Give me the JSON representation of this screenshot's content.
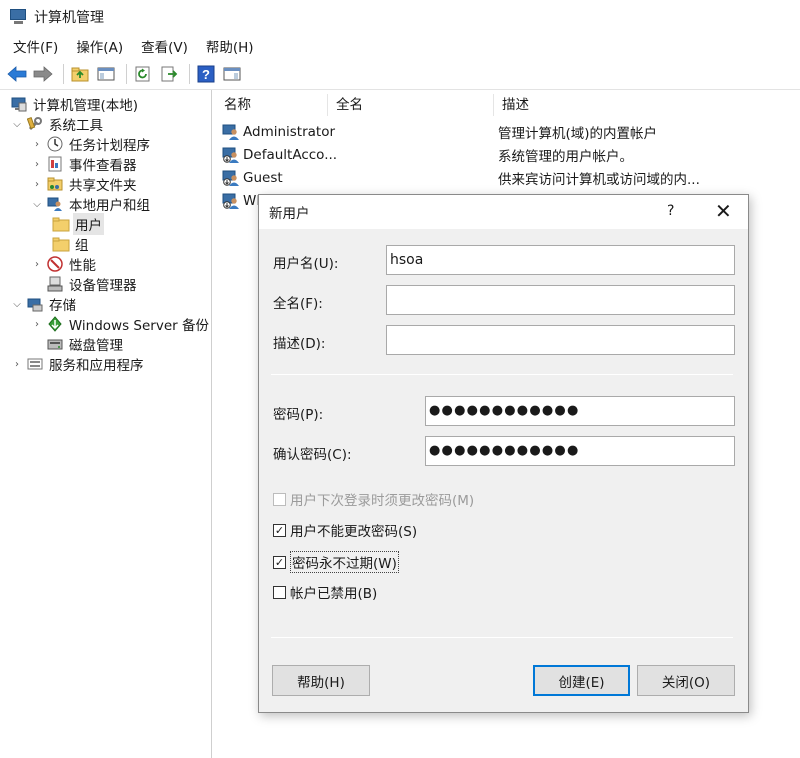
{
  "window": {
    "title": "计算机管理",
    "app_icon": "computer-management-icon"
  },
  "menu": [
    "文件(F)",
    "操作(A)",
    "查看(V)",
    "帮助(H)"
  ],
  "toolbar": {
    "buttons": [
      "back-arrow-icon",
      "forward-arrow-icon",
      "up-folder-icon",
      "show-hide-console-tree-icon",
      "refresh-icon",
      "export-list-icon",
      "help-icon",
      "show-hide-action-pane-icon"
    ]
  },
  "tree": {
    "root": "计算机管理(本地)",
    "system_tools": "系统工具",
    "task_scheduler": "任务计划程序",
    "event_viewer": "事件查看器",
    "shared_folders": "共享文件夹",
    "local_users_groups": "本地用户和组",
    "users": "用户",
    "groups": "组",
    "performance": "性能",
    "device_manager": "设备管理器",
    "storage": "存储",
    "windows_backup": "Windows Server 备份",
    "disk_management": "磁盘管理",
    "services_apps": "服务和应用程序"
  },
  "list": {
    "columns": [
      "名称",
      "全名",
      "描述"
    ],
    "rows": [
      {
        "name": "Administrator",
        "fullname": "",
        "description": "管理计算机(域)的内置帐户"
      },
      {
        "name": "DefaultAcco...",
        "fullname": "",
        "description": "系统管理的用户帐户。"
      },
      {
        "name": "Guest",
        "fullname": "",
        "description": "供来宾访问计算机或访问域的内..."
      },
      {
        "name": "WI",
        "fullname": "",
        "description": ""
      }
    ]
  },
  "dialog": {
    "title": "新用户",
    "help_glyph": "?",
    "close_glyph": "✕",
    "username_label": "用户名(U):",
    "username_value": "hsoa",
    "fullname_label": "全名(F):",
    "fullname_value": "",
    "description_label": "描述(D):",
    "description_value": "",
    "password_label": "密码(P):",
    "password_value": "●●●●●●●●●●●●",
    "confirm_label": "确认密码(C):",
    "confirm_value": "●●●●●●●●●●●●",
    "chk_must_change": {
      "label": "用户下次登录时须更改密码(M)",
      "checked": false,
      "disabled": true
    },
    "chk_cannot_change": {
      "label": "用户不能更改密码(S)",
      "checked": true
    },
    "chk_never_expires": {
      "label": "密码永不过期(W)",
      "checked": true
    },
    "chk_disabled": {
      "label": "帐户已禁用(B)",
      "checked": false
    },
    "help_button": "帮助(H)",
    "create_button": "创建(E)",
    "close_button": "关闭(O)"
  },
  "colors": {
    "accent": "#0078d7",
    "arrow_blue": "#2b7bd6",
    "folder_yellow": "#f3cf6b"
  }
}
